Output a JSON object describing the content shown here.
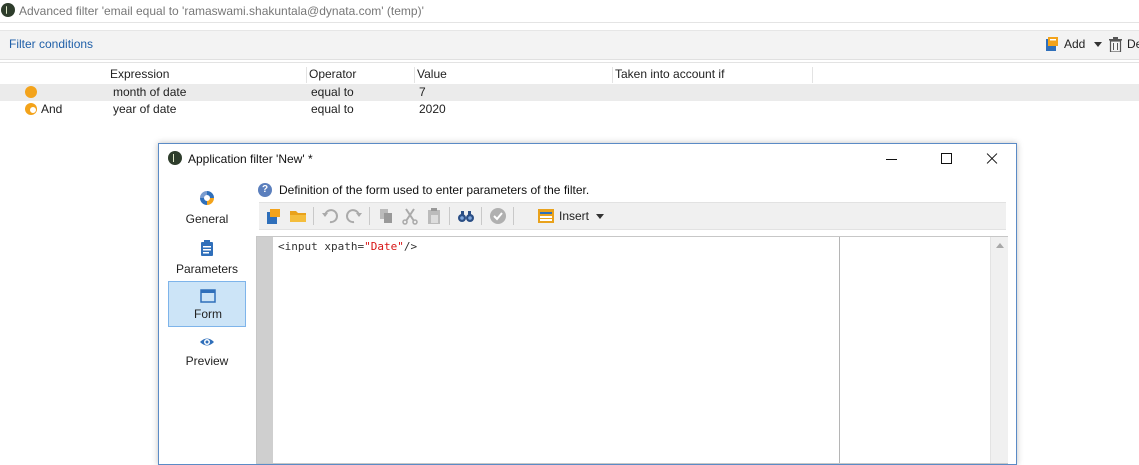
{
  "window": {
    "title": "Advanced filter 'email equal to 'ramaswami.shakuntala@dynata.com' (temp)'"
  },
  "filter_conditions": {
    "title": "Filter conditions",
    "add_label": "Add",
    "delete_label": "De",
    "columns": [
      "Expression",
      "Operator",
      "Value",
      "Taken into account if"
    ],
    "rows": [
      {
        "logic": "",
        "expression": "month of date",
        "operator": "equal to",
        "value": "7",
        "taken_into_account": ""
      },
      {
        "logic": "And",
        "expression": "year of date",
        "operator": "equal to",
        "value": "2020",
        "taken_into_account": ""
      }
    ]
  },
  "dialog": {
    "title": "Application filter 'New' *",
    "nav": [
      {
        "label": "General",
        "icon": "general-icon",
        "active": false
      },
      {
        "label": "Parameters",
        "icon": "clipboard-icon",
        "active": false
      },
      {
        "label": "Form",
        "icon": "form-window-icon",
        "active": true
      },
      {
        "label": "Preview",
        "icon": "eye-icon",
        "active": false
      }
    ],
    "help_text": "Definition of the form used to enter parameters of the filter.",
    "toolbar": {
      "insert_label": "Insert"
    },
    "editor": {
      "code_prefix": "<input xpath=",
      "code_string": "\"Date\"",
      "code_suffix": "/>"
    }
  },
  "colors": {
    "accent_blue": "#1f5fa8",
    "orange": "#f3a31b",
    "nav_active_bg": "#cce4f7",
    "string_red": "#d81414"
  }
}
